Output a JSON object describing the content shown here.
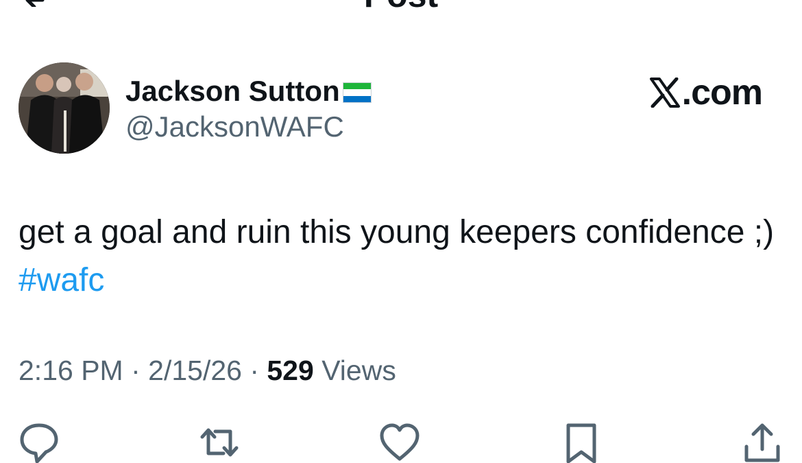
{
  "header": {
    "title": "Post"
  },
  "author": {
    "name": "Jackson Sutton",
    "handle": "@JacksonWAFC",
    "flag_icon": "sierra-leone-flag-icon"
  },
  "source": {
    "label": ".com",
    "logo_icon": "x-logo-icon"
  },
  "post": {
    "text_main": "get a goal and ruin this young keepers confidence ;) ",
    "hashtag": "#wafc"
  },
  "meta": {
    "time": "2:16 PM",
    "sep1": " · ",
    "date": "2/15/26",
    "sep2": " · ",
    "views_count": "529",
    "views_label": " Views"
  },
  "actions": [
    {
      "name": "reply-icon"
    },
    {
      "name": "repost-icon"
    },
    {
      "name": "like-icon"
    },
    {
      "name": "bookmark-icon"
    },
    {
      "name": "share-icon"
    }
  ],
  "colors": {
    "text": "#0f1419",
    "secondary": "#536471",
    "accent": "#1d9bf0",
    "background": "#ffffff"
  }
}
